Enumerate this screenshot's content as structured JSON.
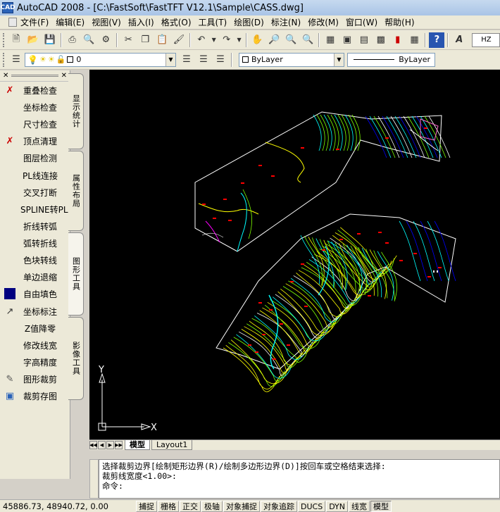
{
  "window": {
    "app_icon": "CAD",
    "title": "AutoCAD 2008 - [C:\\FastSoft\\FastTFT V12.1\\Sample\\CASS.dwg]"
  },
  "menu": [
    "文件(F)",
    "编辑(E)",
    "视图(V)",
    "插入(I)",
    "格式(O)",
    "工具(T)",
    "绘图(D)",
    "标注(N)",
    "修改(M)",
    "窗口(W)",
    "帮助(H)"
  ],
  "toolbar": {
    "hz_value": "HZ",
    "layer_value": "0",
    "color_value": "ByLayer",
    "linetype_value": "ByLayer"
  },
  "left_panel": {
    "items": [
      {
        "label": "重叠检查",
        "icon": "overlap-check-icon"
      },
      {
        "label": "坐标检查",
        "icon": ""
      },
      {
        "label": "尺寸检查",
        "icon": ""
      },
      {
        "label": "顶点清理",
        "icon": "vertex-clean-icon"
      },
      {
        "label": "图层检测",
        "icon": ""
      },
      {
        "label": "PL线连接",
        "icon": ""
      },
      {
        "label": "交叉打断",
        "icon": ""
      },
      {
        "label": "SPLINE转PL",
        "icon": ""
      },
      {
        "label": "折线转弧",
        "icon": ""
      },
      {
        "label": "弧转折线",
        "icon": ""
      },
      {
        "label": "色块转线",
        "icon": ""
      },
      {
        "label": "单边退缩",
        "icon": ""
      },
      {
        "label": "自由填色",
        "icon": "fill-color-icon"
      },
      {
        "label": "坐标标注",
        "icon": "coord-label-icon"
      },
      {
        "label": "Z值降零",
        "icon": ""
      },
      {
        "label": "修改线宽",
        "icon": ""
      },
      {
        "label": "字高精度",
        "icon": ""
      },
      {
        "label": "图形裁剪",
        "icon": "clip-icon"
      },
      {
        "label": "裁剪存图",
        "icon": "clip-save-icon"
      }
    ]
  },
  "side_tabs": [
    "显示统计",
    "属性布局",
    "图形工具",
    "影像工具"
  ],
  "canvas": {
    "axis_x": "X",
    "axis_y": "Y"
  },
  "layout_tabs": [
    "模型",
    "Layout1"
  ],
  "command_lines": [
    "选择裁剪边界[绘制矩形边界(R)/绘制多边形边界(D)]按回车或空格结束选择:",
    " 裁剪线宽度<1.00>:",
    "命令:"
  ],
  "status": {
    "coords": "45886.73, 48940.72, 0.00",
    "buttons": [
      "捕捉",
      "栅格",
      "正交",
      "极轴",
      "对象捕捉",
      "对象追踪",
      "DUCS",
      "DYN",
      "线宽",
      "模型"
    ],
    "active": "模型"
  },
  "colors": {
    "canvas_bg": "#000000",
    "contour_yellow": "#ffff00",
    "contour_green": "#7fff00",
    "cyan": "#00ffff",
    "red": "#ff0000",
    "white": "#ffffff"
  }
}
